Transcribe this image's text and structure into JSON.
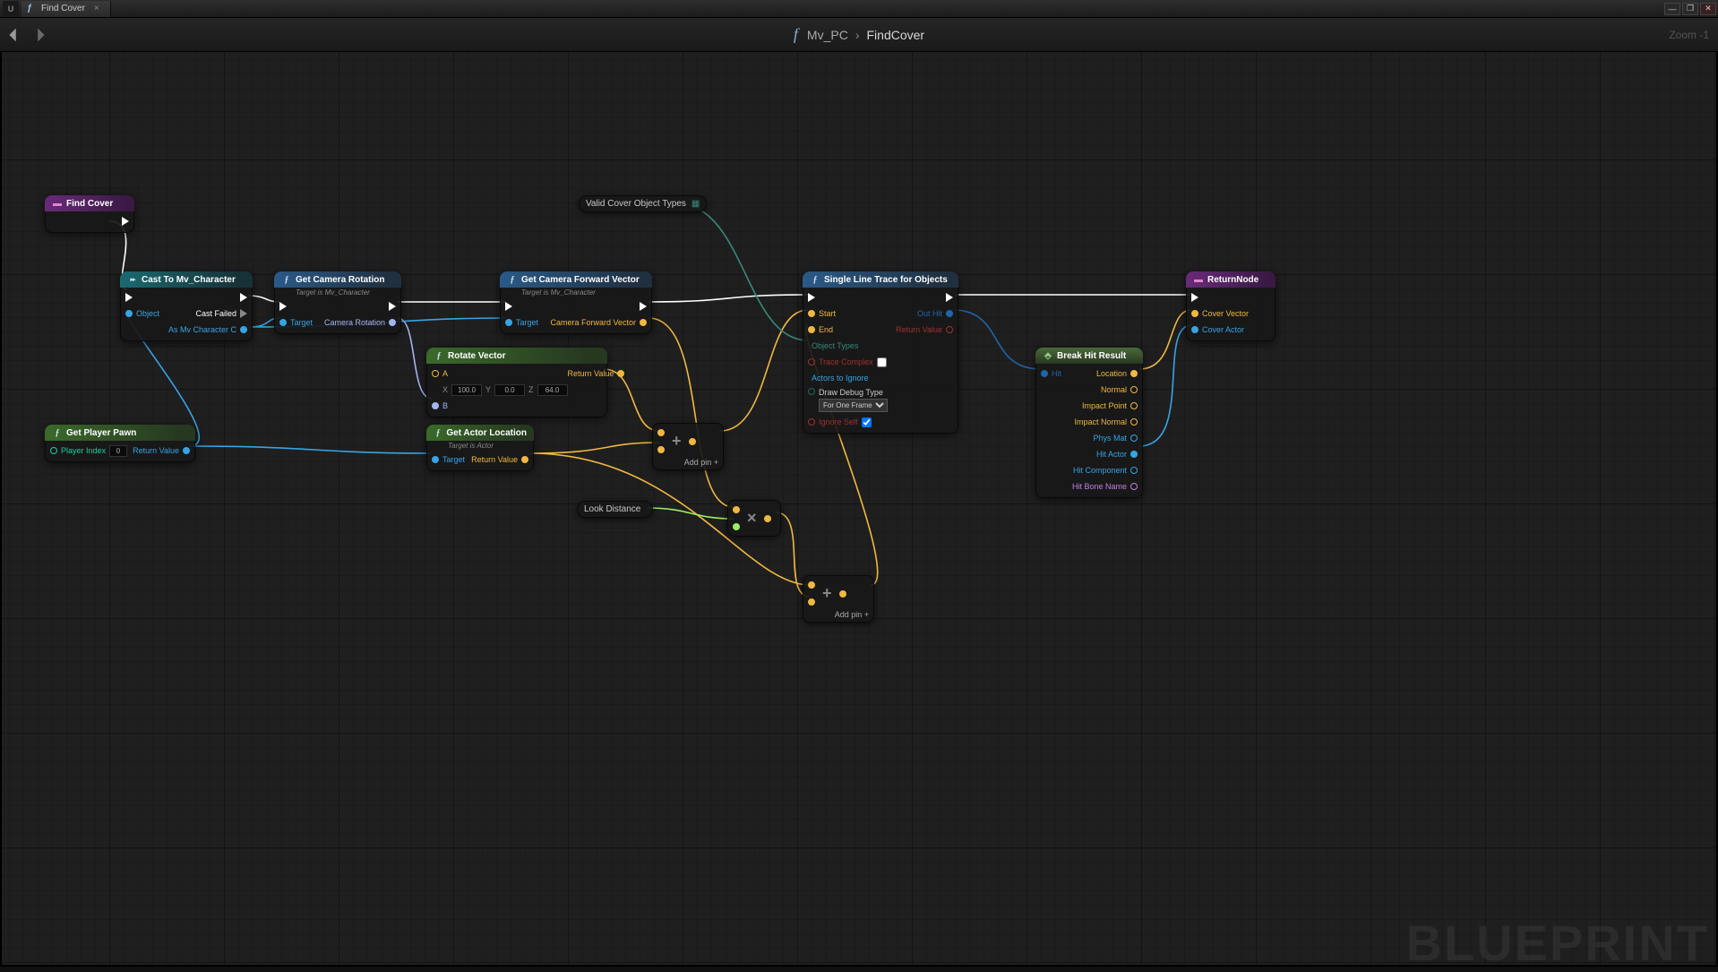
{
  "window": {
    "tab_title": "Find Cover",
    "zoom": "Zoom -1",
    "watermark": "BLUEPRINT"
  },
  "breadcrumb": {
    "parent": "Mv_PC",
    "current": "FindCover"
  },
  "nodes": {
    "findcover": {
      "title": "Find Cover"
    },
    "cast": {
      "title": "Cast To Mv_Character",
      "pin_object": "Object",
      "pin_castfailed": "Cast Failed",
      "pin_as": "As Mv Character C"
    },
    "getpawn": {
      "title": "Get Player Pawn",
      "pin_playerindex": "Player Index",
      "playerindex_val": "0",
      "pin_return": "Return Value"
    },
    "getrot": {
      "title": "Get Camera Rotation",
      "subtitle": "Target is Mv_Character",
      "pin_target": "Target",
      "pin_return": "Camera Rotation"
    },
    "getfwd": {
      "title": "Get Camera Forward Vector",
      "subtitle": "Target is Mv_Character",
      "pin_target": "Target",
      "pin_return": "Camera Forward Vector"
    },
    "rotate": {
      "title": "Rotate Vector",
      "pin_a": "A",
      "pin_b": "B",
      "pin_return": "Return Value",
      "x_label": "X",
      "y_label": "Y",
      "z_label": "Z",
      "x": "100.0",
      "y": "0.0",
      "z": "64.0"
    },
    "getloc": {
      "title": "Get Actor Location",
      "subtitle": "Target is Actor",
      "pin_target": "Target",
      "pin_return": "Return Value"
    },
    "validtypes": {
      "label": "Valid Cover Object Types"
    },
    "lookdist": {
      "label": "Look Distance"
    },
    "trace": {
      "title": "Single Line Trace for Objects",
      "pin_start": "Start",
      "pin_end": "End",
      "pin_objtypes": "Object Types",
      "pin_tracecomplex": "Trace Complex",
      "pin_actors": "Actors to Ignore",
      "pin_debugtype": "Draw Debug Type",
      "debugtype_val": "For One Frame",
      "pin_ignoreself": "Ignore Self",
      "pin_outhit": "Out Hit",
      "pin_returnvalue": "Return Value"
    },
    "break": {
      "title": "Break Hit Result",
      "pin_hit": "Hit",
      "out_location": "Location",
      "out_normal": "Normal",
      "out_impactpoint": "Impact Point",
      "out_impactnormal": "Impact Normal",
      "out_physmat": "Phys Mat",
      "out_hitactor": "Hit Actor",
      "out_hitcomponent": "Hit Component",
      "out_hitbonename": "Hit Bone Name"
    },
    "return": {
      "title": "ReturnNode",
      "pin_covervec": "Cover Vector",
      "pin_coveractor": "Cover Actor"
    },
    "addpin": "Add pin"
  }
}
